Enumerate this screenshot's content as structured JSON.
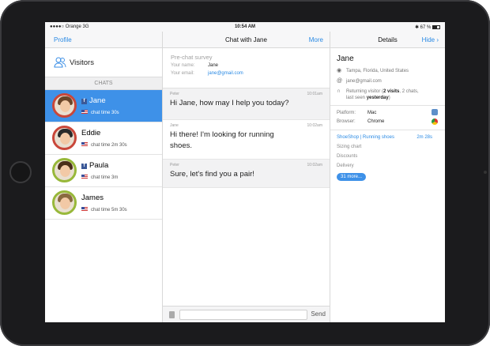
{
  "status": {
    "carrier": "Orange",
    "network": "3G",
    "time": "10:54 AM",
    "battery": "67 %",
    "battery_level": 0.67
  },
  "left": {
    "nav_button": "Profile",
    "visitors_label": "Visitors",
    "section_label": "CHATS",
    "chats": [
      {
        "name": "Jane",
        "meta": "chat time 30s",
        "facebook": true,
        "active": true
      },
      {
        "name": "Eddie",
        "meta": "chat time 2m 30s",
        "facebook": false,
        "active": false
      },
      {
        "name": "Paula",
        "meta": "chat time 3m",
        "facebook": true,
        "active": false
      },
      {
        "name": "James",
        "meta": "chat time 5m 30s",
        "facebook": false,
        "active": false
      }
    ],
    "fb_glyph": "f"
  },
  "chat": {
    "title": "Chat with Jane",
    "more_button": "More",
    "survey": {
      "heading": "Pre-chat survey",
      "name_label": "Your name:",
      "name_value": "Jane",
      "email_label": "Your email:",
      "email_value": "jane@gmail.com"
    },
    "messages": [
      {
        "sender": "Peter",
        "time": "10:01am",
        "text": "Hi Jane, how may I help you today?"
      },
      {
        "sender": "Jane",
        "time": "10:02am",
        "text": "Hi there! I'm looking for running shoes."
      },
      {
        "sender": "Peter",
        "time": "10:02am",
        "text": "Sure, let's find you a pair!"
      }
    ],
    "send_button": "Send"
  },
  "details": {
    "title": "Details",
    "hide_button": "Hide",
    "name": "Jane",
    "location": "Tampa, Florida, United States",
    "email": "jane@gmail.com",
    "returning": {
      "pre": "Returning visitor (",
      "visits": "2 visits",
      "mid": ", 2 chats,",
      "last": "last seen ",
      "yesterday": "yesterday",
      "end": ")"
    },
    "platform_label": "Platform:",
    "platform_value": "Mac",
    "browser_label": "Browser:",
    "browser_value": "Chrome",
    "pages": {
      "first": "ShoeShop | Running shoes",
      "first_duration": "2m 28s",
      "items": [
        "Sizing chart",
        "Discounts",
        "Delivery"
      ],
      "more": "31 more..."
    }
  }
}
